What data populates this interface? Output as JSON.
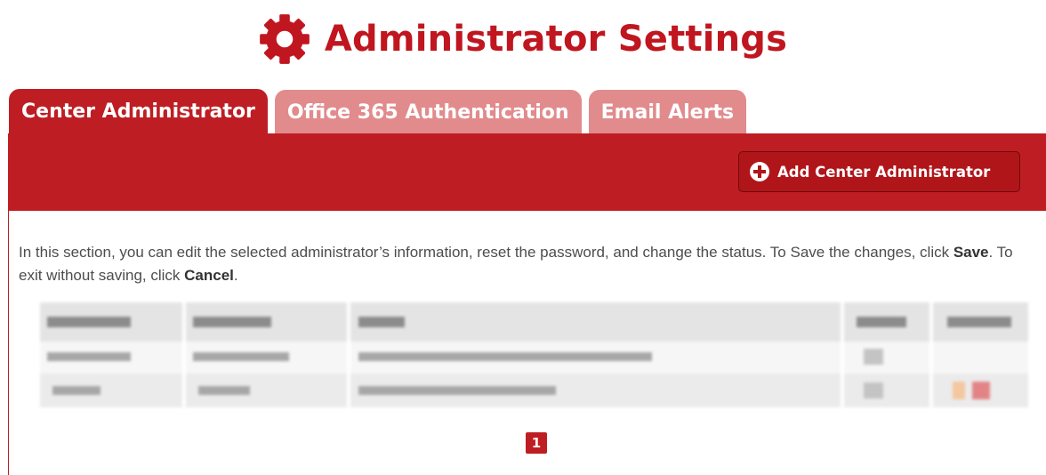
{
  "header": {
    "title": "Administrator Settings",
    "icon": "gear-icon",
    "accent_color": "#c0161f"
  },
  "tabs": [
    {
      "label": "Center Administrator",
      "active": true
    },
    {
      "label": "Office 365 Authentication",
      "active": false
    },
    {
      "label": "Email Alerts",
      "active": false
    }
  ],
  "toolbar": {
    "add_button_label": "Add Center Administrator",
    "add_button_icon": "plus-circle-icon"
  },
  "instructions": {
    "text1": "In this section, you can edit the selected administrator’s information, reset the password, and change the status. To Save the changes, click ",
    "bold1": "Save",
    "text2": ". To exit without saving, click ",
    "bold2": "Cancel",
    "text3": "."
  },
  "pagination": {
    "current_page": "1"
  },
  "colors": {
    "primary": "#be1e23",
    "tab_inactive": "#e18b8d",
    "text": "#4d4d4d"
  }
}
